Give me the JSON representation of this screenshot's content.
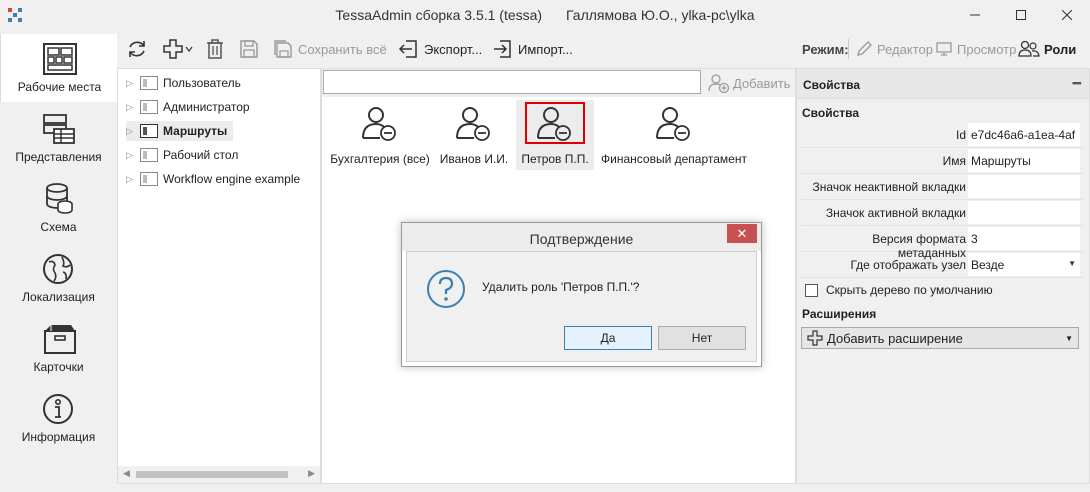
{
  "window": {
    "app_title": "TessaAdmin сборка 3.5.1 (tessa)",
    "user_info": "Галлямова Ю.О., ylka-pc\\ylka"
  },
  "sidebar": {
    "items": [
      {
        "label": "Рабочие места",
        "icon": "workspace-grid-icon",
        "active": true
      },
      {
        "label": "Представления",
        "icon": "views-table-icon"
      },
      {
        "label": "Схема",
        "icon": "database-icon"
      },
      {
        "label": "Локализация",
        "icon": "globe-icon"
      },
      {
        "label": "Карточки",
        "icon": "box-icon"
      },
      {
        "label": "Информация",
        "icon": "info-icon"
      }
    ]
  },
  "toolbar": {
    "save_all": "Сохранить всё",
    "export": "Экспорт...",
    "import": "Импорт...",
    "mode_label": "Режим:",
    "mode_editor": "Редактор",
    "mode_preview": "Просмотр",
    "mode_roles": "Роли"
  },
  "tree": {
    "items": [
      {
        "label": "Пользователь"
      },
      {
        "label": "Администратор"
      },
      {
        "label": "Маршруты",
        "selected": true
      },
      {
        "label": "Рабочий стол"
      },
      {
        "label": "Workflow engine example"
      }
    ]
  },
  "center": {
    "search_value": "",
    "add_label": "Добавить",
    "roles": [
      {
        "name": "Бухгалтерия (все)"
      },
      {
        "name": "Иванов И.И."
      },
      {
        "name": "Петров П.П.",
        "selected": true
      },
      {
        "name": "Финансовый департамент"
      }
    ]
  },
  "properties": {
    "panel_title": "Свойства",
    "section_title": "Свойства",
    "rows": [
      {
        "label": "Id",
        "value": "e7dc46a6-a1ea-4af"
      },
      {
        "label": "Имя",
        "value": "Маршруты"
      },
      {
        "label": "Значок неактивной вкладки",
        "value": ""
      },
      {
        "label": "Значок активной вкладки",
        "value": ""
      },
      {
        "label": "Версия формата метаданных",
        "value": "3"
      },
      {
        "label": "Где отображать узел",
        "value": "Везде"
      }
    ],
    "hide_tree_label": "Скрыть дерево по умолчанию",
    "extensions_title": "Расширения",
    "add_extension_label": "Добавить расширение"
  },
  "dialog": {
    "title": "Подтверждение",
    "message": "Удалить роль 'Петров П.П.'?",
    "yes_label": "Да",
    "no_label": "Нет"
  },
  "colors": {
    "accent": "#3c7fb1",
    "close_red": "#c75050",
    "highlight_red": "#e00000"
  }
}
